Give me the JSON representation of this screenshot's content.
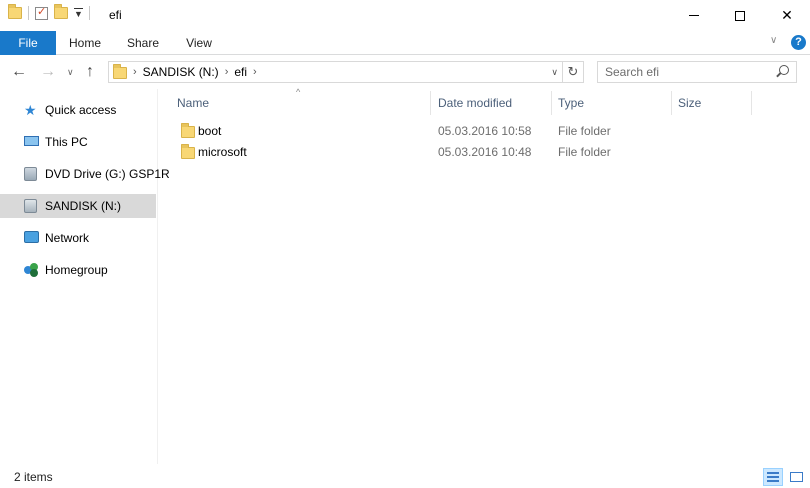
{
  "window": {
    "title": "efi",
    "controls": {
      "minimize": "minimize",
      "maximize": "maximize",
      "close": "✕"
    }
  },
  "quick_access_toolbar": {
    "icons": [
      "folder-icon",
      "properties-check-icon",
      "new-folder-icon",
      "customize-dropdown-icon"
    ]
  },
  "ribbon": {
    "tabs": [
      {
        "label": "File",
        "active": true
      },
      {
        "label": "Home"
      },
      {
        "label": "Share"
      },
      {
        "label": "View"
      }
    ],
    "accent_color": "#1979ca"
  },
  "address_bar": {
    "breadcrumbs": [
      "SANDISK (N:)",
      "efi"
    ],
    "search_placeholder": "Search efi"
  },
  "nav_pane": {
    "items": [
      {
        "label": "Quick access",
        "icon": "star-icon"
      },
      {
        "label": "This PC",
        "icon": "computer-icon"
      },
      {
        "label": "DVD Drive (G:) GSP1R",
        "icon": "dvd-drive-icon"
      },
      {
        "label": "SANDISK (N:)",
        "icon": "usb-drive-icon",
        "selected": true
      },
      {
        "label": "Network",
        "icon": "network-icon"
      },
      {
        "label": "Homegroup",
        "icon": "homegroup-icon"
      }
    ]
  },
  "file_list": {
    "columns": [
      "Name",
      "Date modified",
      "Type",
      "Size"
    ],
    "rows": [
      {
        "name": "boot",
        "date_modified": "05.03.2016 10:58",
        "type": "File folder",
        "size": ""
      },
      {
        "name": "microsoft",
        "date_modified": "05.03.2016 10:48",
        "type": "File folder",
        "size": ""
      }
    ]
  },
  "status_bar": {
    "item_count": "2 items"
  }
}
